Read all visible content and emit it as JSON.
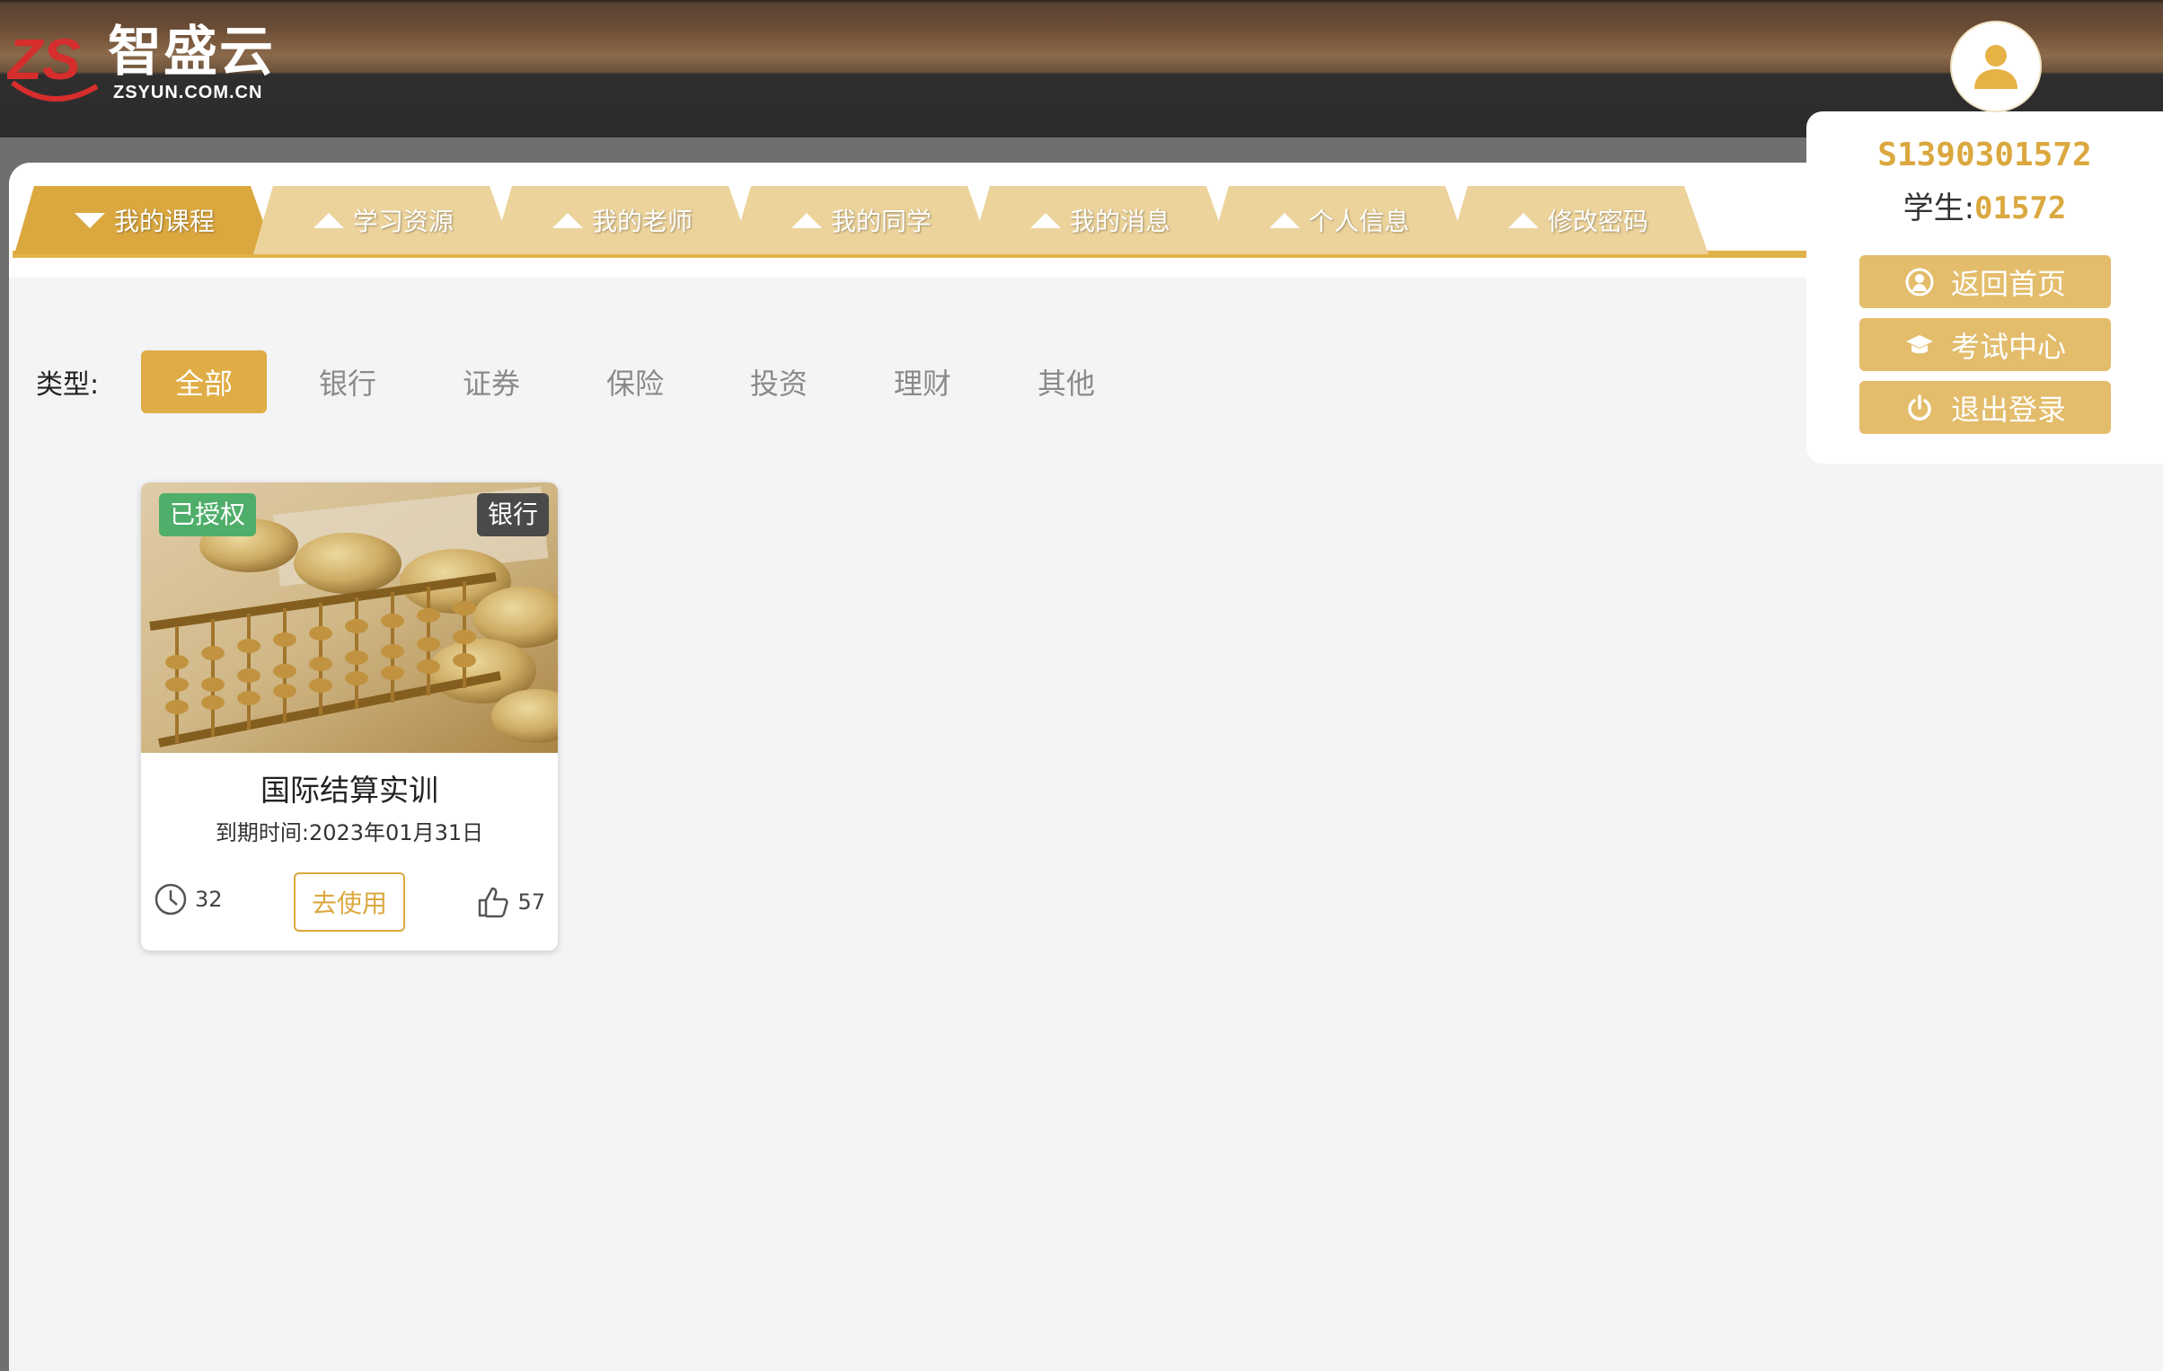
{
  "header": {
    "logo_cn": "智盛云",
    "logo_en": "ZSYUN.COM.CN"
  },
  "tabs": [
    {
      "label": "我的课程",
      "active": true
    },
    {
      "label": "学习资源",
      "active": false
    },
    {
      "label": "我的老师",
      "active": false
    },
    {
      "label": "我的同学",
      "active": false
    },
    {
      "label": "我的消息",
      "active": false
    },
    {
      "label": "个人信息",
      "active": false
    },
    {
      "label": "修改密码",
      "active": false
    }
  ],
  "filter": {
    "label": "类型:",
    "options": [
      "全部",
      "银行",
      "证券",
      "保险",
      "投资",
      "理财",
      "其他"
    ],
    "selected": "全部"
  },
  "courses": [
    {
      "auth_badge": "已授权",
      "type_badge": "银行",
      "title": "国际结算实训",
      "expire": "到期时间:2023年01月31日",
      "views": "32",
      "use_label": "去使用",
      "likes": "57"
    }
  ],
  "user": {
    "id": "S1390301572",
    "role_label": "学生:",
    "role_num": "01572",
    "menu": [
      {
        "label": "返回首页",
        "icon": "user-circle-icon"
      },
      {
        "label": "考试中心",
        "icon": "graduation-cap-icon"
      },
      {
        "label": "退出登录",
        "icon": "power-icon"
      }
    ]
  },
  "colors": {
    "accent": "#dba83f",
    "tab_inactive": "#ecd39b",
    "auth_green": "#4fae6a",
    "menu_button": "#e3bd6c"
  }
}
